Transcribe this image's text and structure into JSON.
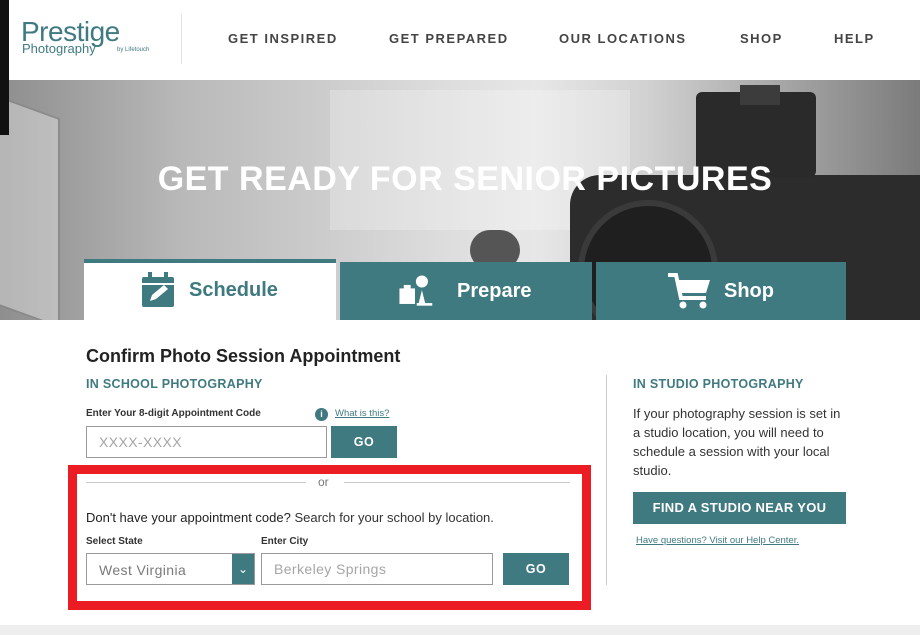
{
  "brand": {
    "name": "Prestige",
    "sub": "Photography",
    "tiny": "by Lifetouch",
    "accent": "#3f7a80"
  },
  "nav": [
    {
      "label": "GET INSPIRED"
    },
    {
      "label": "GET PREPARED"
    },
    {
      "label": "OUR LOCATIONS"
    },
    {
      "label": "SHOP"
    },
    {
      "label": "HELP"
    }
  ],
  "hero": {
    "title": "GET READY FOR SENIOR PICTURES"
  },
  "tabs": [
    {
      "label": "Schedule",
      "icon": "calendar-edit-icon",
      "active": true
    },
    {
      "label": "Prepare",
      "icon": "props-icon",
      "active": false
    },
    {
      "label": "Shop",
      "icon": "cart-icon",
      "active": false
    }
  ],
  "main": {
    "title": "Confirm Photo Session Appointment",
    "school_heading": "IN SCHOOL PHOTOGRAPHY",
    "code_label": "Enter Your 8-digit Appointment Code",
    "what_is_this": "What is this?",
    "code_placeholder": "XXXX-XXXX",
    "go_label": "GO",
    "or_text": "or",
    "no_code_bold": "Don't have your appointment code?",
    "no_code_rest": " Search for your school by location.",
    "state_label": "Select State",
    "state_value": "West Virginia",
    "city_label": "Enter City",
    "city_placeholder": "Berkeley Springs",
    "go2_label": "GO"
  },
  "studio": {
    "heading": "IN STUDIO PHOTOGRAPHY",
    "text": "If your photography session is set in a studio location, you will need to schedule a session with your local studio.",
    "button": "FIND A STUDIO NEAR YOU",
    "help_link": "Have questions? Visit our Help Center."
  },
  "highlight_color": "#ec1c24"
}
